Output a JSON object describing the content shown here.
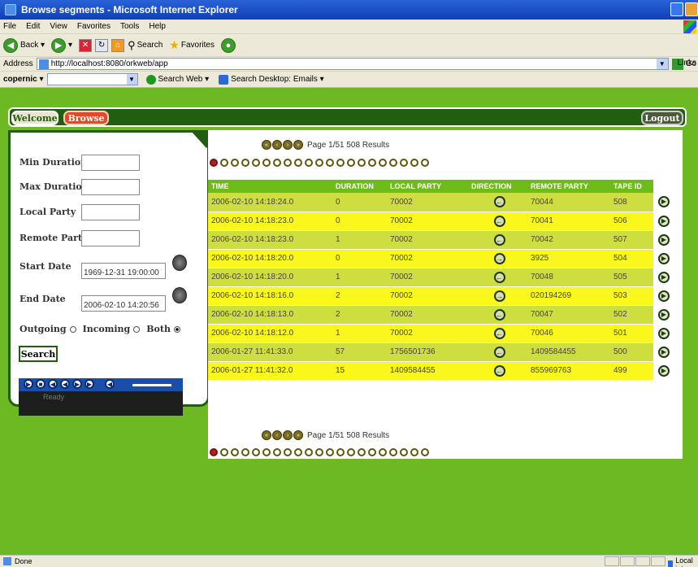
{
  "window": {
    "title": "Browse segments - Microsoft Internet Explorer"
  },
  "menu": [
    "File",
    "Edit",
    "View",
    "Favorites",
    "Tools",
    "Help"
  ],
  "toolbar": {
    "back": "Back",
    "search": "Search",
    "favorites": "Favorites"
  },
  "address": {
    "label": "Address",
    "url": "http://localhost:8080/orkweb/app",
    "go": "Go",
    "links": "Links"
  },
  "copernic": {
    "brand": "copernic",
    "search_web": "Search Web",
    "search_desktop": "Search Desktop: Emails"
  },
  "nav": {
    "welcome": "Welcome",
    "browse": "Browse",
    "logout": "Logout"
  },
  "filters": {
    "min_duration_label": "Min Duration",
    "min_duration": "",
    "max_duration_label": "Max Duration",
    "max_duration": "",
    "local_party_label": "Local Party",
    "local_party": "",
    "remote_party_label": "Remote Party",
    "remote_party": "",
    "start_date_label": "Start Date",
    "start_date": "1969-12-31 19:00:00",
    "end_date_label": "End Date",
    "end_date": "2006-02-10 14:20:56",
    "outgoing": "Outgoing",
    "incoming": "Incoming",
    "both": "Both",
    "direction_selected": "Both",
    "search": "Search"
  },
  "player": {
    "status": "Ready"
  },
  "pagination": {
    "text": "Page 1/51 508 Results",
    "page_count_dots": 21,
    "current_dot": 1
  },
  "table": {
    "headers": [
      "TIME",
      "DURATION",
      "LOCAL PARTY",
      "DIRECTION",
      "REMOTE PARTY",
      "TAPE ID"
    ],
    "rows": [
      {
        "time": "2006-02-10 14:18:24.0",
        "duration": "0",
        "local": "70002",
        "direction": "in",
        "remote": "70044",
        "tape": "508"
      },
      {
        "time": "2006-02-10 14:18:23.0",
        "duration": "0",
        "local": "70002",
        "direction": "in",
        "remote": "70041",
        "tape": "506"
      },
      {
        "time": "2006-02-10 14:18:23.0",
        "duration": "1",
        "local": "70002",
        "direction": "in",
        "remote": "70042",
        "tape": "507"
      },
      {
        "time": "2006-02-10 14:18:20.0",
        "duration": "0",
        "local": "70002",
        "direction": "out",
        "remote": "3925",
        "tape": "504"
      },
      {
        "time": "2006-02-10 14:18:20.0",
        "duration": "1",
        "local": "70002",
        "direction": "in",
        "remote": "70048",
        "tape": "505"
      },
      {
        "time": "2006-02-10 14:18:16.0",
        "duration": "2",
        "local": "70002",
        "direction": "out",
        "remote": "020194269",
        "tape": "503"
      },
      {
        "time": "2006-02-10 14:18:13.0",
        "duration": "2",
        "local": "70002",
        "direction": "in",
        "remote": "70047",
        "tape": "502"
      },
      {
        "time": "2006-02-10 14:18:12.0",
        "duration": "1",
        "local": "70002",
        "direction": "in",
        "remote": "70046",
        "tape": "501"
      },
      {
        "time": "2006-01-27 11:41:33.0",
        "duration": "57",
        "local": "1756501736",
        "direction": "in",
        "remote": "1409584455",
        "tape": "500"
      },
      {
        "time": "2006-01-27 11:41:32.0",
        "duration": "15",
        "local": "1409584455",
        "direction": "in",
        "remote": "855969763",
        "tape": "499"
      }
    ]
  },
  "status": {
    "left": "Done",
    "zone": "Local intranet"
  },
  "colors": {
    "bg_green": "#6db924",
    "dark_green": "#215e0f",
    "row_a": "#cede3e",
    "row_b": "#f9f71b",
    "header_green": "#6fbb17",
    "browse_red": "#e04a2a"
  }
}
